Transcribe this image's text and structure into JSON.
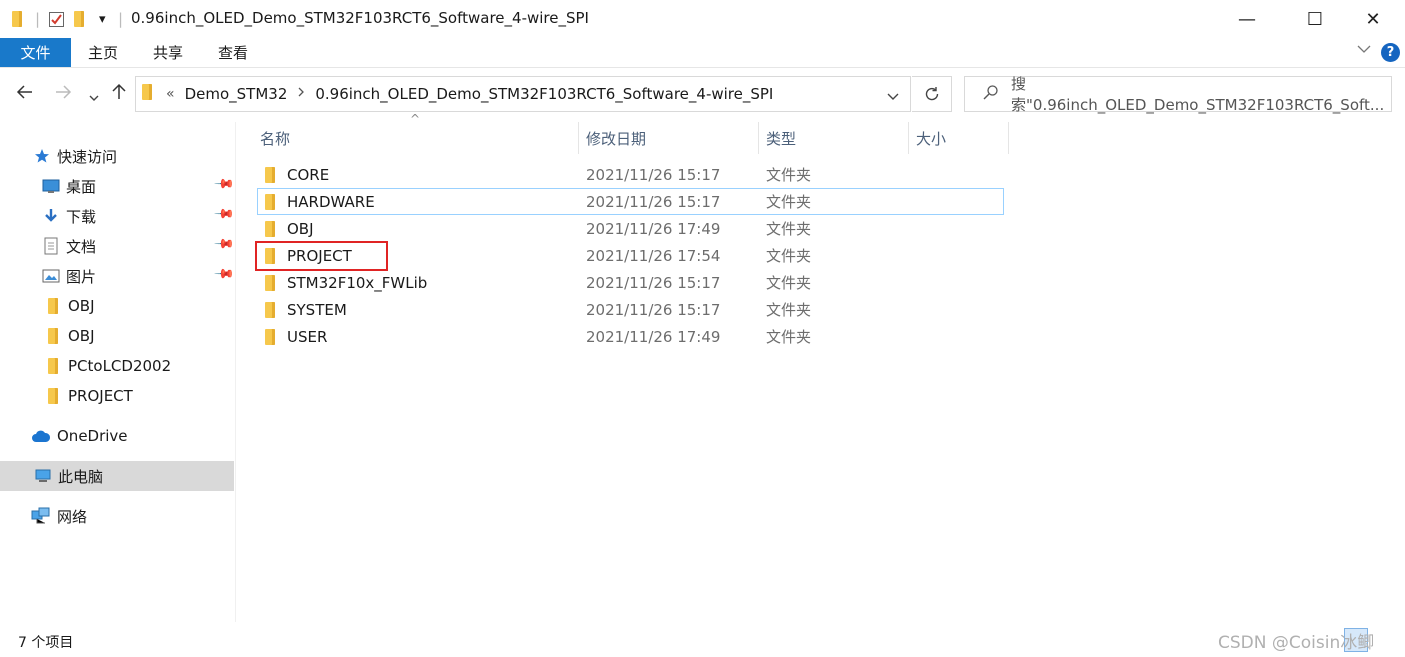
{
  "window": {
    "title": "0.96inch_OLED_Demo_STM32F103RCT6_Software_4-wire_SPI",
    "qa_dropdown": "▾",
    "minimize": "—",
    "maximize": "☐",
    "close": "✕"
  },
  "ribbon": {
    "tabs": [
      "文件",
      "主页",
      "共享",
      "查看"
    ],
    "expand_icon": "chevron-down-icon",
    "help": "?"
  },
  "address": {
    "overflow": "«",
    "segments": [
      "Demo_STM32",
      "0.96inch_OLED_Demo_STM32F103RCT6_Software_4-wire_SPI"
    ],
    "search_placeholder": "搜索\"0.96inch_OLED_Demo_STM32F103RCT6_Soft..."
  },
  "navpane": {
    "items": [
      {
        "label": "快速访问",
        "icon": "star-icon",
        "pinned": false
      },
      {
        "label": "桌面",
        "icon": "desktop-icon",
        "pinned": true
      },
      {
        "label": "下载",
        "icon": "download-icon",
        "pinned": true
      },
      {
        "label": "文档",
        "icon": "document-icon",
        "pinned": true
      },
      {
        "label": "图片",
        "icon": "picture-icon",
        "pinned": true
      },
      {
        "label": "OBJ",
        "icon": "folder-icon",
        "pinned": false
      },
      {
        "label": "OBJ",
        "icon": "folder-icon",
        "pinned": false
      },
      {
        "label": "PCtoLCD2002",
        "icon": "folder-icon",
        "pinned": false
      },
      {
        "label": "PROJECT",
        "icon": "folder-icon",
        "pinned": false
      },
      {
        "label": "OneDrive",
        "icon": "cloud-icon",
        "pinned": false
      },
      {
        "label": "此电脑",
        "icon": "computer-icon",
        "pinned": false,
        "selected": true
      },
      {
        "label": "网络",
        "icon": "network-icon",
        "pinned": false
      }
    ]
  },
  "columns": {
    "name": "名称",
    "date": "修改日期",
    "type": "类型",
    "size": "大小",
    "sort_caret": "^"
  },
  "files": [
    {
      "name": "CORE",
      "date": "2021/11/26 15:17",
      "type": "文件夹"
    },
    {
      "name": "HARDWARE",
      "date": "2021/11/26 15:17",
      "type": "文件夹"
    },
    {
      "name": "OBJ",
      "date": "2021/11/26 17:49",
      "type": "文件夹"
    },
    {
      "name": "PROJECT",
      "date": "2021/11/26 17:54",
      "type": "文件夹"
    },
    {
      "name": "STM32F10x_FWLib",
      "date": "2021/11/26 15:17",
      "type": "文件夹"
    },
    {
      "name": "SYSTEM",
      "date": "2021/11/26 15:17",
      "type": "文件夹"
    },
    {
      "name": "USER",
      "date": "2021/11/26 17:49",
      "type": "文件夹"
    }
  ],
  "status": {
    "count": "7 个项目",
    "watermark": "CSDN @Coisin冰鲫"
  },
  "colors": {
    "accent": "#1979ca",
    "highlight_box": "#e02424",
    "folder": "#f8cf5a"
  }
}
